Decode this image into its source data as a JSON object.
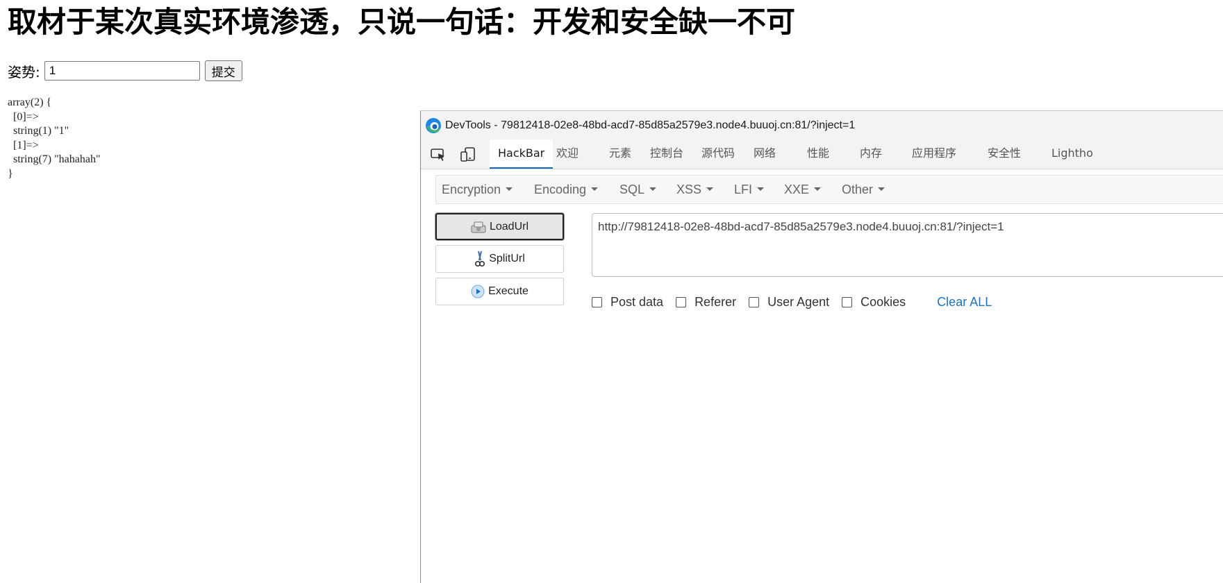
{
  "page": {
    "title": "取材于某次真实环境渗透，只说一句话：开发和安全缺一不可",
    "form": {
      "label": "姿势:",
      "input_value": "1",
      "submit_label": "提交"
    },
    "dump_lines": [
      "array(2) {",
      "  [0]=>",
      "  string(1) \"1\"",
      "  [1]=>",
      "  string(7) \"hahahah\"",
      "}"
    ]
  },
  "devtools": {
    "window_title": "DevTools - 79812418-02e8-48bd-acd7-85d85a2579e3.node4.buuoj.cn:81/?inject=1",
    "toolbar_icons": [
      "inspect-element-icon",
      "device-emulation-icon"
    ],
    "tabs": [
      "HackBar",
      "欢迎",
      "元素",
      "控制台",
      "源代码",
      "网络",
      "性能",
      "内存",
      "应用程序",
      "安全性",
      "Lightho"
    ],
    "active_tab": "HackBar",
    "hackbar": {
      "menus": [
        "Encryption",
        "Encoding",
        "SQL",
        "XSS",
        "LFI",
        "XXE",
        "Other"
      ],
      "buttons": {
        "load_url": "LoadUrl",
        "split_url": "SplitUrl",
        "execute": "Execute"
      },
      "url_value": "http://79812418-02e8-48bd-acd7-85d85a2579e3.node4.buuoj.cn:81/?inject=1",
      "options": [
        "Post data",
        "Referer",
        "User Agent",
        "Cookies"
      ],
      "clear_all": "Clear ALL",
      "accent_color": "#1d6fbf"
    }
  }
}
